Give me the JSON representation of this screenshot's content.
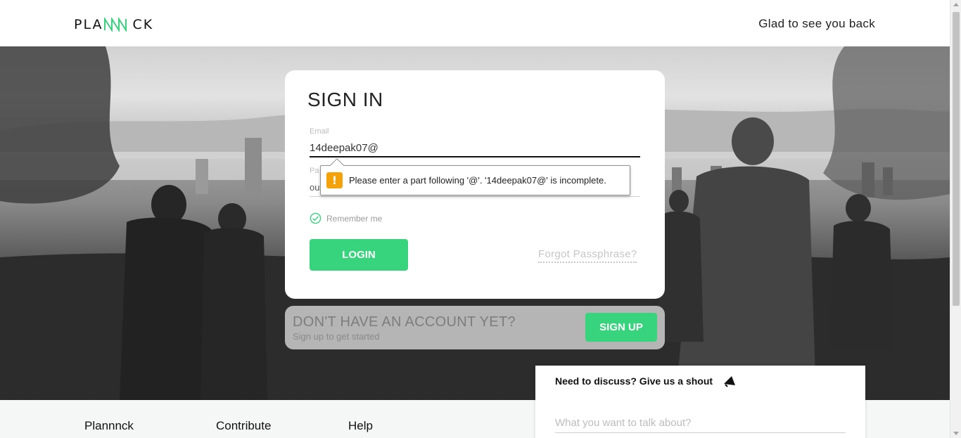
{
  "header": {
    "logo_left": "PLA",
    "logo_right": "CK",
    "welcome": "Glad to see you back"
  },
  "signin": {
    "title": "SIGN IN",
    "email_label": "Email",
    "email_value": "14deepak07@",
    "password_label": "Pa",
    "password_value": "ou",
    "remember_label": "Remember me",
    "login_label": "LOGIN",
    "forgot_label": "Forgot Passphrase?"
  },
  "validation": {
    "icon": "warning-icon",
    "message": "Please enter a part following '@'. '14deepak07@' is incomplete."
  },
  "signup": {
    "heading": "DON'T HAVE AN ACCOUNT YET?",
    "subtext": "Sign up to get started",
    "button_label": "SIGN UP"
  },
  "footer": {
    "columns": [
      "Plannnck",
      "Contribute",
      "Help"
    ]
  },
  "shout": {
    "title": "Need to discuss? Give us a shout",
    "icon": "megaphone-icon",
    "placeholder": "What you want to talk about?"
  },
  "colors": {
    "accent": "#38d47d",
    "warning": "#f5a10a"
  }
}
